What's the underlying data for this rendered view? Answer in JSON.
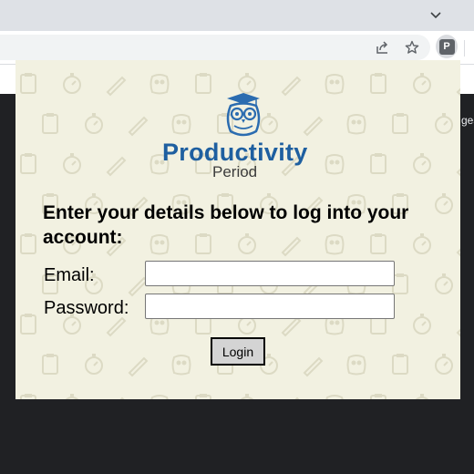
{
  "browser": {
    "extension_letter": "P",
    "icons": [
      "chevron-down-icon",
      "share-icon",
      "star-icon",
      "extension-icon"
    ]
  },
  "page_edge_text": "ges",
  "popup": {
    "logo": {
      "name": "Productivity",
      "subtitle": "Period",
      "brand_color": "#1e5fa0",
      "owl_color": "#2b6cb0"
    },
    "heading": "Enter your details below to log into your account:",
    "fields": [
      {
        "label": "Email:",
        "value": ""
      },
      {
        "label": "Password:",
        "value": ""
      }
    ],
    "login_label": "Login",
    "background_color": "#f2f1e1"
  }
}
